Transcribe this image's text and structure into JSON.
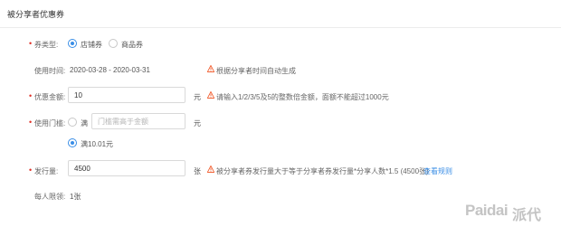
{
  "title": "被分享者优惠券",
  "coupon_type": {
    "label": "券类型:",
    "options": [
      "店铺券",
      "商品券"
    ]
  },
  "use_time": {
    "label": "使用时间:",
    "value": "2020-03-28 - 2020-03-31",
    "note": "根据分享者时间自动生成"
  },
  "amount": {
    "label": "优惠金额:",
    "value": "10",
    "unit": "元",
    "note": "请输入1/2/3/5及5的整数倍金额，面额不能超过1000元"
  },
  "threshold": {
    "label": "使用门槛:",
    "option_full_prefix": "满",
    "placeholder": "门槛需高于金额",
    "unit": "元",
    "option_preset": "满10.01元"
  },
  "issue": {
    "label": "发行量:",
    "value": "4500",
    "unit": "张",
    "note": "被分享者券发行量大于等于分享者券发行量*分享人数*1.5 (4500张)",
    "link": "查看规则"
  },
  "per_person": {
    "label": "每人限领:",
    "value": "1张"
  },
  "watermark": {
    "text": "Paidai",
    "text_cn": "派代"
  },
  "colors": {
    "accent": "#3a8ee6",
    "required": "#e02e24",
    "warning": "#f0501e"
  }
}
